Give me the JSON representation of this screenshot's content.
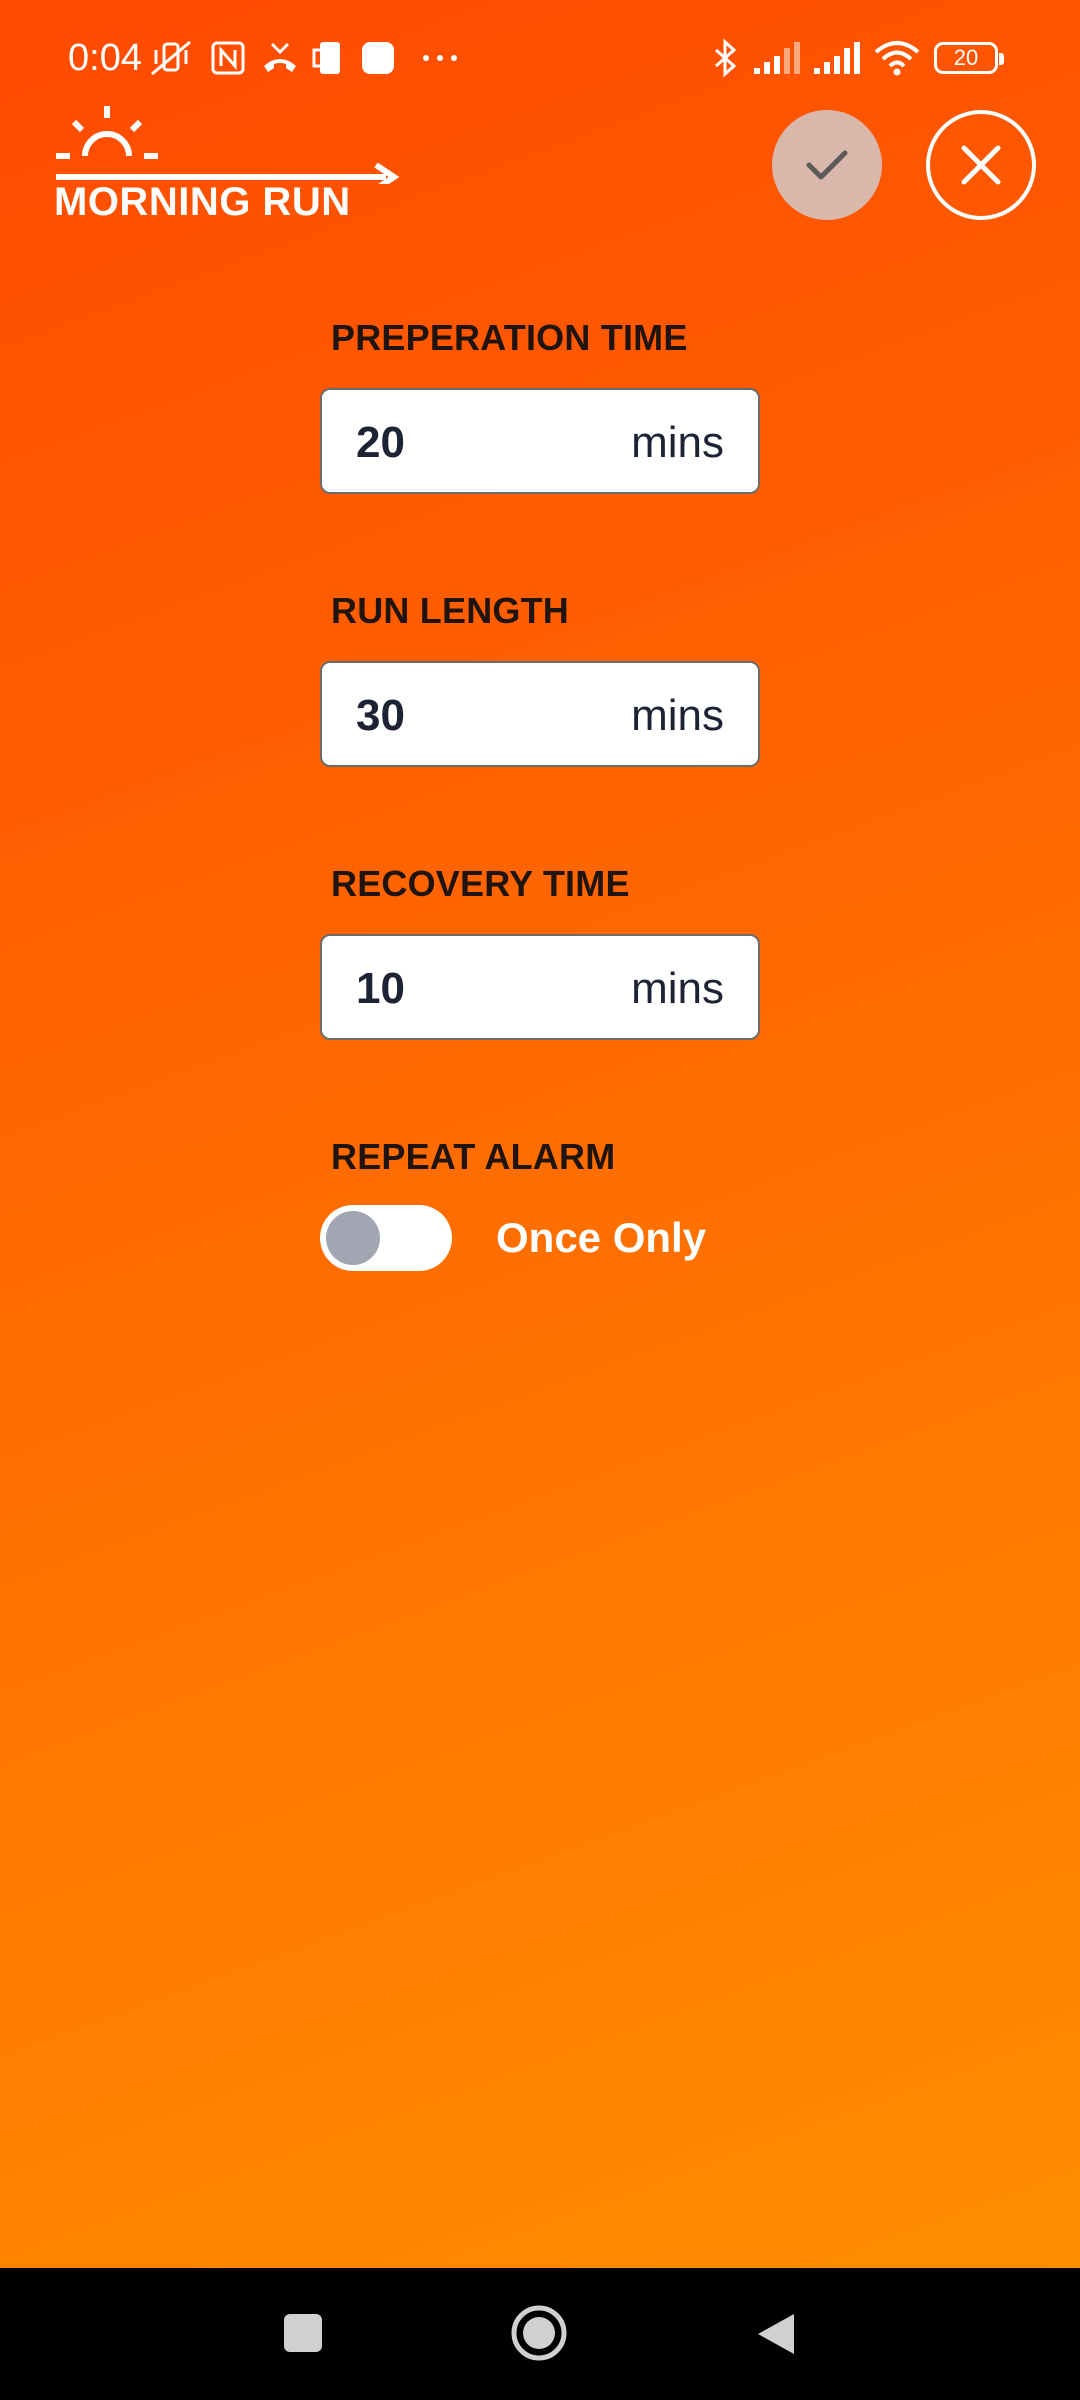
{
  "status_bar": {
    "time": "0:04",
    "battery": "20",
    "icons": [
      "mute-vibrate-icon",
      "nfc-icon",
      "missed-call-icon",
      "screen-cast-icon",
      "app-notification-icon",
      "more-notifications-icon",
      "bluetooth-icon",
      "signal-icon",
      "signal-icon",
      "wifi-icon",
      "battery-icon"
    ]
  },
  "header": {
    "logo_text": "MORNING RUN",
    "confirm_icon": "check-icon",
    "close_icon": "close-icon"
  },
  "form": {
    "preparation": {
      "label": "PREPERATION TIME",
      "value": "20",
      "unit": "mins"
    },
    "run_length": {
      "label": "RUN LENGTH",
      "value": "30",
      "unit": "mins"
    },
    "recovery": {
      "label": "RECOVERY TIME",
      "value": "10",
      "unit": "mins"
    },
    "repeat": {
      "label": "REPEAT ALARM",
      "state": "Once Only",
      "enabled": false
    }
  },
  "nav_bar": {
    "icons": [
      "recents-icon",
      "home-icon",
      "back-icon"
    ]
  },
  "colors": {
    "gradient_start": "#ff4a00",
    "gradient_end": "#ff8d00",
    "label_text": "#1f1410",
    "value_text": "#1e2235",
    "toggle_knob": "#a2a6b3",
    "confirm_bg": "#d9b7aa"
  }
}
